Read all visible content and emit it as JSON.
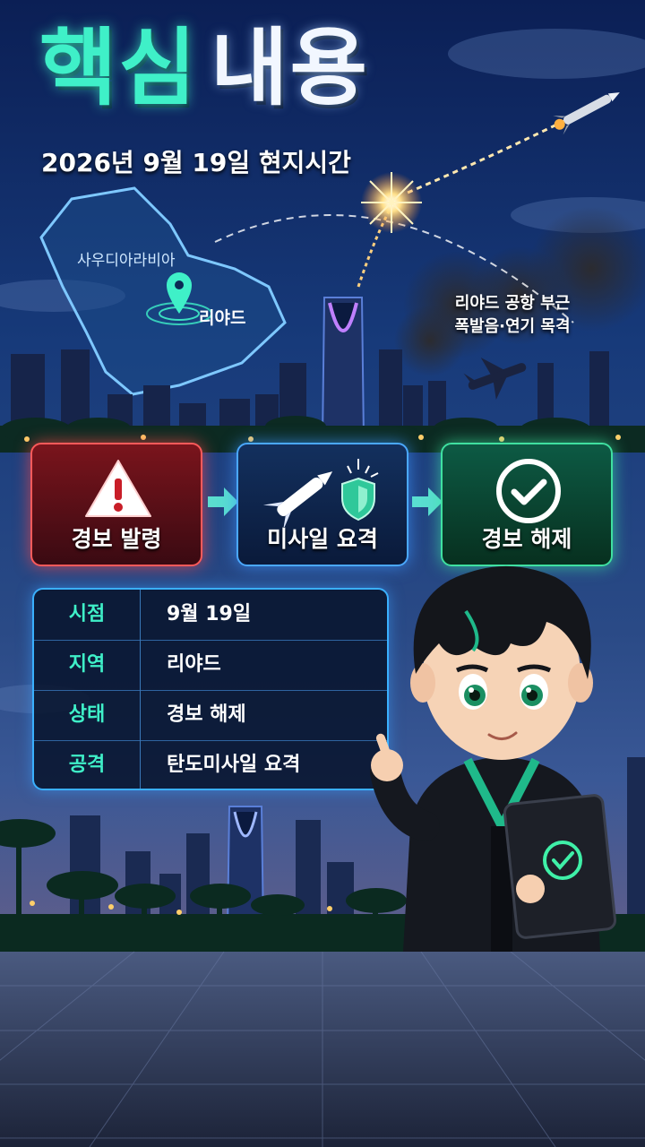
{
  "header": {
    "title_part1": "핵심",
    "title_part2": "내용",
    "subtitle": "2026년 9월 19일 현지시간"
  },
  "map": {
    "country_label": "사우디아라비아",
    "city_label": "리야드"
  },
  "witness_note": {
    "line1": "리야드 공항 부근",
    "line2": "폭발음·연기 목격"
  },
  "flow": [
    {
      "label": "경보 발령",
      "icon": "warning-triangle-icon",
      "color": "#ff5a5a"
    },
    {
      "label": "미사일 요격",
      "icon": "missile-shield-icon",
      "color": "#4aa8ff"
    },
    {
      "label": "경보 해제",
      "icon": "check-circle-icon",
      "color": "#3fe0a0"
    }
  ],
  "info_table": {
    "rows": [
      {
        "key": "시점",
        "value": "9월 19일"
      },
      {
        "key": "지역",
        "value": "리야드"
      },
      {
        "key": "상태",
        "value": "경보 해제"
      },
      {
        "key": "공격",
        "value": "탄도미사일 요격"
      }
    ]
  },
  "colors": {
    "accent": "#3ff0c8",
    "alert": "#ff5a5a",
    "info_blue": "#3ab0ff",
    "clear_green": "#3fe0a0"
  }
}
